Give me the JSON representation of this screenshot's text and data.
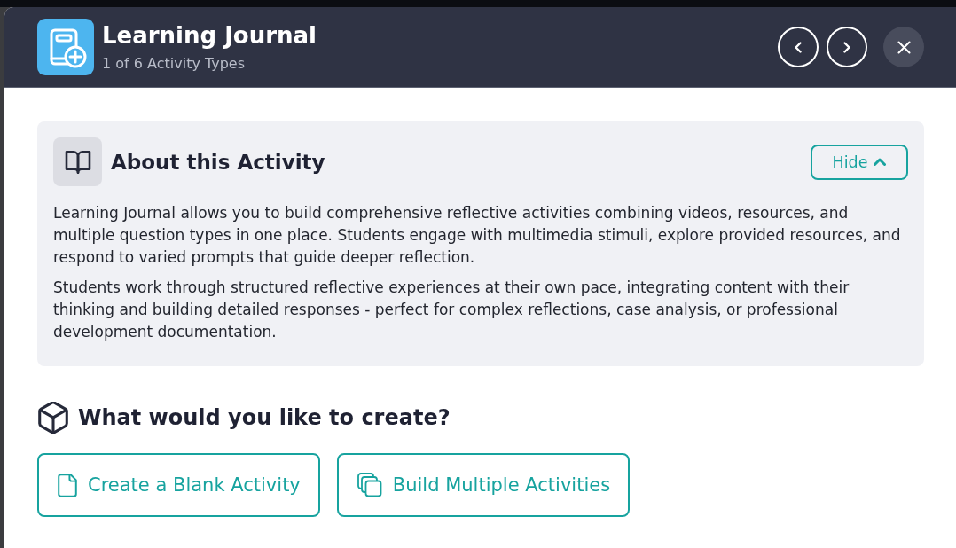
{
  "header": {
    "title": "Learning Journal",
    "subtitle": "1 of 6 Activity Types"
  },
  "about": {
    "title": "About this Activity",
    "toggle": {
      "label": "Hide",
      "expanded": true
    },
    "paragraphs": [
      "Learning Journal allows you to build comprehensive reflective activities combining videos, resources, and multiple question types in one place. Students engage with multimedia stimuli, explore provided resources, and respond to varied prompts that guide deeper reflection.",
      "Students work through structured reflective experiences at their own pace, integrating content with their thinking and building detailed responses - perfect for complex reflections, case analysis, or professional development documentation."
    ]
  },
  "create": {
    "title": "What would you like to create?",
    "options": [
      {
        "kind": "blank",
        "label": "Create a Blank Activity"
      },
      {
        "kind": "multiple",
        "label": "Build Multiple Activities"
      }
    ]
  }
}
